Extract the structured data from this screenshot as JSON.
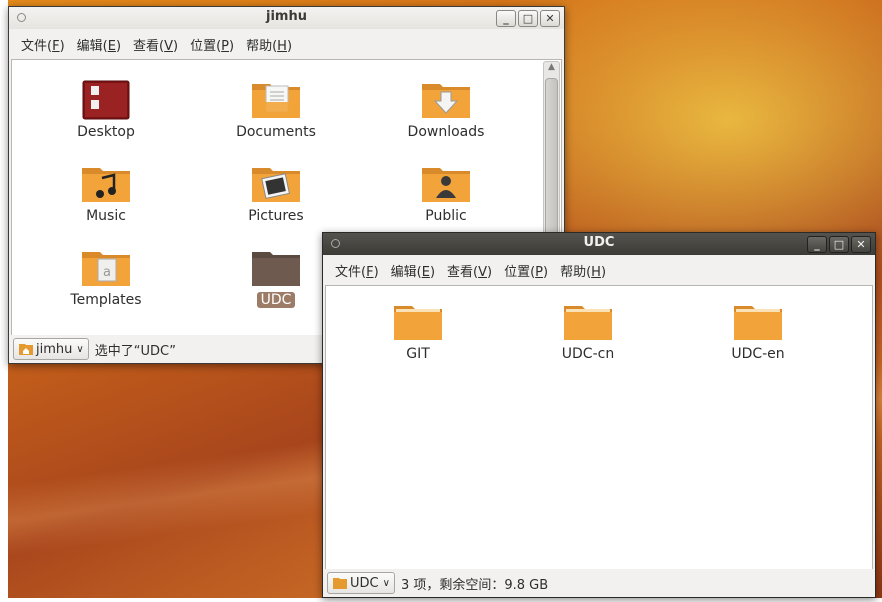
{
  "desktop": {
    "bg_accent": "#e48a1a"
  },
  "windows": {
    "jimhu": {
      "title": "jimhu",
      "controls": {
        "minimize": "_",
        "maximize": "□",
        "close": "✕"
      },
      "menu": [
        {
          "label": "文件(",
          "key": "F",
          "end": ")"
        },
        {
          "label": "编辑(",
          "key": "E",
          "end": ")"
        },
        {
          "label": "查看(",
          "key": "V",
          "end": ")"
        },
        {
          "label": "位置(",
          "key": "P",
          "end": ")"
        },
        {
          "label": "帮助(",
          "key": "H",
          "end": ")"
        }
      ],
      "items": [
        {
          "label": "Desktop",
          "icon": "desktop-folder-icon"
        },
        {
          "label": "Documents",
          "icon": "documents-folder-icon"
        },
        {
          "label": "Downloads",
          "icon": "downloads-folder-icon"
        },
        {
          "label": "Music",
          "icon": "music-folder-icon"
        },
        {
          "label": "Pictures",
          "icon": "pictures-folder-icon"
        },
        {
          "label": "Public",
          "icon": "public-folder-icon"
        },
        {
          "label": "Templates",
          "icon": "templates-folder-icon"
        },
        {
          "label": "UDC",
          "icon": "folder-icon",
          "selected": true
        }
      ],
      "status": {
        "location": "jimhu",
        "text": "选中了“UDC”"
      }
    },
    "udc": {
      "title": "UDC",
      "controls": {
        "minimize": "_",
        "maximize": "□",
        "close": "✕"
      },
      "menu": [
        {
          "label": "文件(",
          "key": "F",
          "end": ")"
        },
        {
          "label": "编辑(",
          "key": "E",
          "end": ")"
        },
        {
          "label": "查看(",
          "key": "V",
          "end": ")"
        },
        {
          "label": "位置(",
          "key": "P",
          "end": ")"
        },
        {
          "label": "帮助(",
          "key": "H",
          "end": ")"
        }
      ],
      "items": [
        {
          "label": "GIT",
          "icon": "folder-icon"
        },
        {
          "label": "UDC-cn",
          "icon": "folder-icon"
        },
        {
          "label": "UDC-en",
          "icon": "folder-icon"
        }
      ],
      "status": {
        "location": "UDC",
        "text": "3 项，剩余空间：9.8 GB"
      }
    }
  }
}
